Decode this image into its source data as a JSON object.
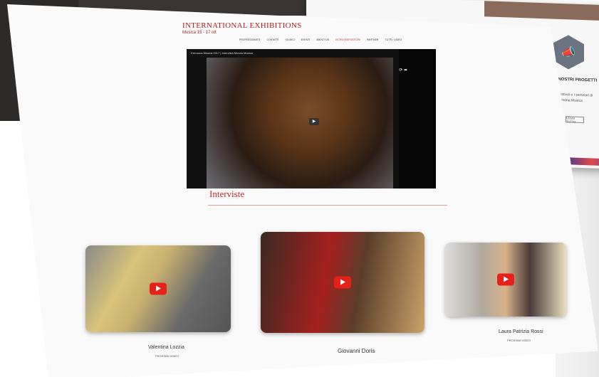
{
  "header": {
    "logo": "INTERNATIONAL EXHIBITIONS",
    "logo_sub": "Musica 15 - 17 ott"
  },
  "nav": [
    "PROFESSIONISTI",
    "CONTATTI",
    "GIUDICI",
    "EVENTI",
    "ABOUT US",
    "ISCRIVI ESPOSITORI",
    "PARTNER",
    "TUTTI I VIDEO"
  ],
  "video": {
    "title": "Cremona Musica 2017 | Intervista Mondo Musica"
  },
  "section": {
    "title": "Interviste"
  },
  "cards": [
    {
      "name": "Valentina Lozzia",
      "more": "PROSSIMI VIDEO"
    },
    {
      "name": "Giovanni Doris",
      "more": ""
    },
    {
      "name": "Laura Patrizia Rossi",
      "more": "PROSSIMI VIDEO"
    }
  ],
  "back_screen": {
    "heading": "I NOSTRI PROGETTI",
    "text": "I Festival e i seminari di Cremona Musica",
    "button": "LEGGI TUTTO"
  },
  "colors": {
    "accent": "#c62828",
    "youtube": "#e62117"
  }
}
